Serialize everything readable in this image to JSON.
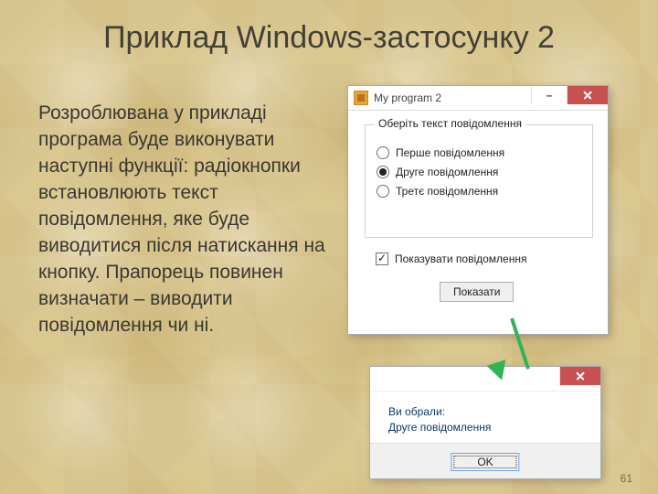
{
  "slide": {
    "title": "Приклад Windows-застосунку 2",
    "body": "Розроблювана у прикладі програма буде виконувати наступні функції: радіокнопки встановлюють текст повідомлення, яке буде виводитися після натискання на кнопку. Прапорець повинен визначати – виводити повідомлення чи ні.",
    "page": "61"
  },
  "window1": {
    "title": "My program 2",
    "group_legend": "Оберіть текст повідомлення",
    "radios": [
      "Перше повідомлення",
      "Друге повідомлення",
      "Третє повідомлення"
    ],
    "selected": 1,
    "checkbox_label": "Показувати повідомлення",
    "checkbox_checked": true,
    "button": "Показати"
  },
  "window2": {
    "line1": "Ви обрали:",
    "line2": "Друге повідомлення",
    "ok": "OK"
  }
}
